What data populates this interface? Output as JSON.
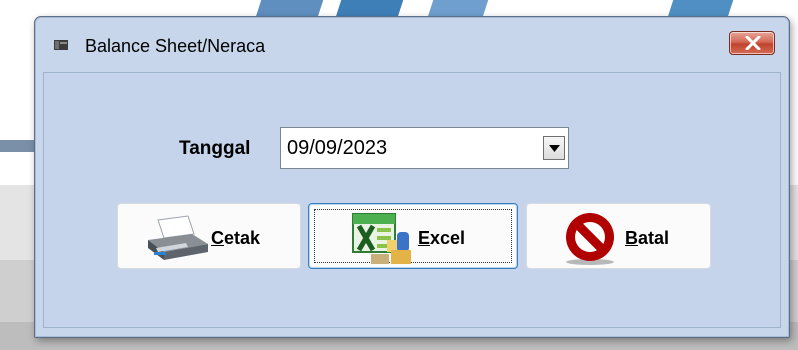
{
  "window": {
    "title": "Balance Sheet/Neraca"
  },
  "form": {
    "date_label": "Tanggal",
    "date_value": "09/09/2023"
  },
  "buttons": {
    "print": {
      "accel": "C",
      "rest": "etak"
    },
    "excel": {
      "accel": "E",
      "rest": "xcel"
    },
    "cancel": {
      "accel": "B",
      "rest": "atal"
    }
  },
  "icons": {
    "title": "window-app-icon",
    "print": "printer-icon",
    "excel": "excel-export-icon",
    "cancel": "prohibited-sign-icon"
  },
  "colors": {
    "window_bg": "#c7d6ea",
    "close_button": "#c0432e",
    "focus_border": "#3a7fc2"
  }
}
